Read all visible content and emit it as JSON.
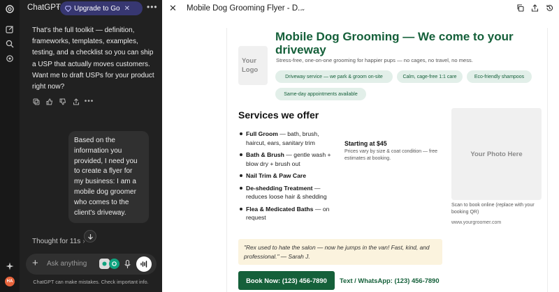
{
  "colors": {
    "sidebar_bg": "#181818",
    "chat_bg": "#212121",
    "upgrade_bg": "#373771",
    "brand_green": "#15603a",
    "chip_bg": "#e2efe9",
    "quote_bg": "#fbf3de"
  },
  "sidebar": {
    "icons": [
      "chatgpt-logo-icon",
      "new-chat-icon",
      "search-icon",
      "library-icon",
      "sparkle-icon",
      "avatar"
    ],
    "avatar_initials": "HA"
  },
  "chat": {
    "app_title": "ChatGPT",
    "upgrade_label": "Upgrade to Go",
    "assistant_text": "That's the full toolkit — definition, frameworks, templates, examples, testing, and a checklist so you can ship a USP that actually moves customers. Want me to draft USPs for your product right now?",
    "user_text": "Based on the information you provided, I need you to create a flyer for my business: I am a mobile dog groomer who comes to the client's driveway.",
    "thought_label": "Thought for 11s",
    "composer_placeholder": "Ask anything",
    "disclaimer": "ChatGPT can make mistakes. Check important info."
  },
  "document": {
    "title": "Mobile Dog Grooming Flyer - D...",
    "flyer": {
      "logo_placeholder": "Your Logo",
      "headline": "Mobile Dog Grooming — We come to your driveway",
      "tagline": "Stress-free, one-on-one grooming for happier pups — no cages, no travel, no mess.",
      "chips": [
        "Driveway service — we park & groom on-site",
        "Calm, cage-free 1:1 care",
        "Eco-friendly shampoos",
        "Same-day appointments available"
      ],
      "services_heading": "Services we offer",
      "services": [
        {
          "name": "Full Groom",
          "desc": " — bath, brush, haircut, ears, sanitary trim"
        },
        {
          "name": "Bath & Brush",
          "desc": " — gentle wash + blow dry + brush out"
        },
        {
          "name": "Nail Trim & Paw Care",
          "desc": ""
        },
        {
          "name": "De-shedding Treatment",
          "desc": " — reduces loose hair & shedding"
        },
        {
          "name": "Flea & Medicated Baths",
          "desc": " — on request"
        }
      ],
      "price_heading": "Starting at $45",
      "price_note": "Prices vary by size & coat condition — free estimates at booking.",
      "photo_placeholder": "Your Photo Here",
      "scan_text": "Scan to book online (replace with your booking QR)",
      "website": "www.yourgroomer.com",
      "testimonial": "\"Rex used to hate the salon — now he jumps in the van! Fast, kind, and professional.\" — Sarah J.",
      "cta_primary": "Book Now: (123) 456-7890",
      "cta_secondary": "Text / WhatsApp: (123) 456-7890"
    }
  }
}
